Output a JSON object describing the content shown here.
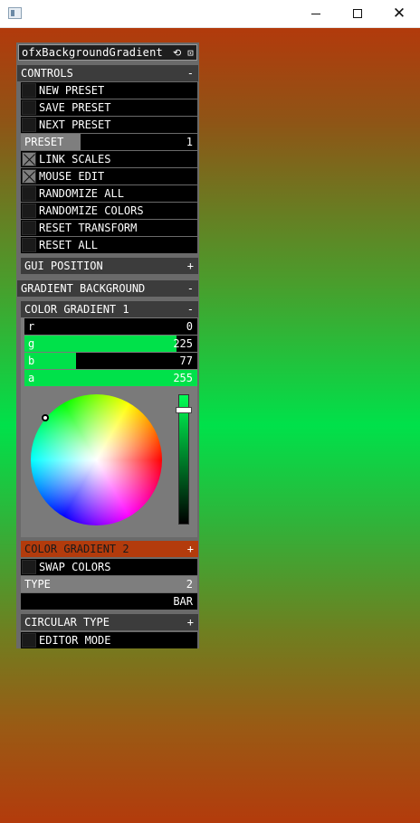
{
  "colors": {
    "panel_bg": "#6a6a6a",
    "row_bg": "#000000",
    "header_bg": "#3c3c3c",
    "accent_green": "#00e14a",
    "accent_orange": "#b33b0c"
  },
  "panel": {
    "title": "ofxBackgroundGradient",
    "title_icons": "⟲ ⊡"
  },
  "controls": {
    "header": "CONTROLS",
    "sign": "-",
    "new_preset": "NEW PRESET",
    "save_preset": "SAVE PRESET",
    "next_preset": "NEXT PRESET",
    "preset_label": "PRESET",
    "preset_value": "1",
    "link_scales": "LINK SCALES",
    "link_scales_on": true,
    "mouse_edit": "MOUSE EDIT",
    "mouse_edit_on": true,
    "randomize_all": "RANDOMIZE ALL",
    "randomize_colors": "RANDOMIZE COLORS",
    "reset_transform": "RESET TRANSFORM",
    "reset_all": "RESET ALL"
  },
  "gui_position": {
    "header": "GUI POSITION",
    "sign": "+"
  },
  "gradient_background": {
    "header": "GRADIENT BACKGROUND",
    "sign": "-"
  },
  "color_gradient_1": {
    "header": "COLOR GRADIENT 1",
    "sign": "-",
    "channels": [
      {
        "label": "r",
        "value": "0",
        "fraction": 0.0
      },
      {
        "label": "g",
        "value": "225",
        "fraction": 0.88
      },
      {
        "label": "b",
        "value": "77",
        "fraction": 0.3
      },
      {
        "label": "a",
        "value": "255",
        "fraction": 1.0
      }
    ],
    "picker_alpha": 0.9
  },
  "color_gradient_2": {
    "header": "COLOR GRADIENT 2",
    "sign": "+"
  },
  "swap_colors": "SWAP COLORS",
  "type": {
    "label": "TYPE",
    "value": "2",
    "name": "BAR"
  },
  "circular_type": {
    "header": "CIRCULAR TYPE",
    "sign": "+"
  },
  "editor_mode": "EDITOR MODE"
}
